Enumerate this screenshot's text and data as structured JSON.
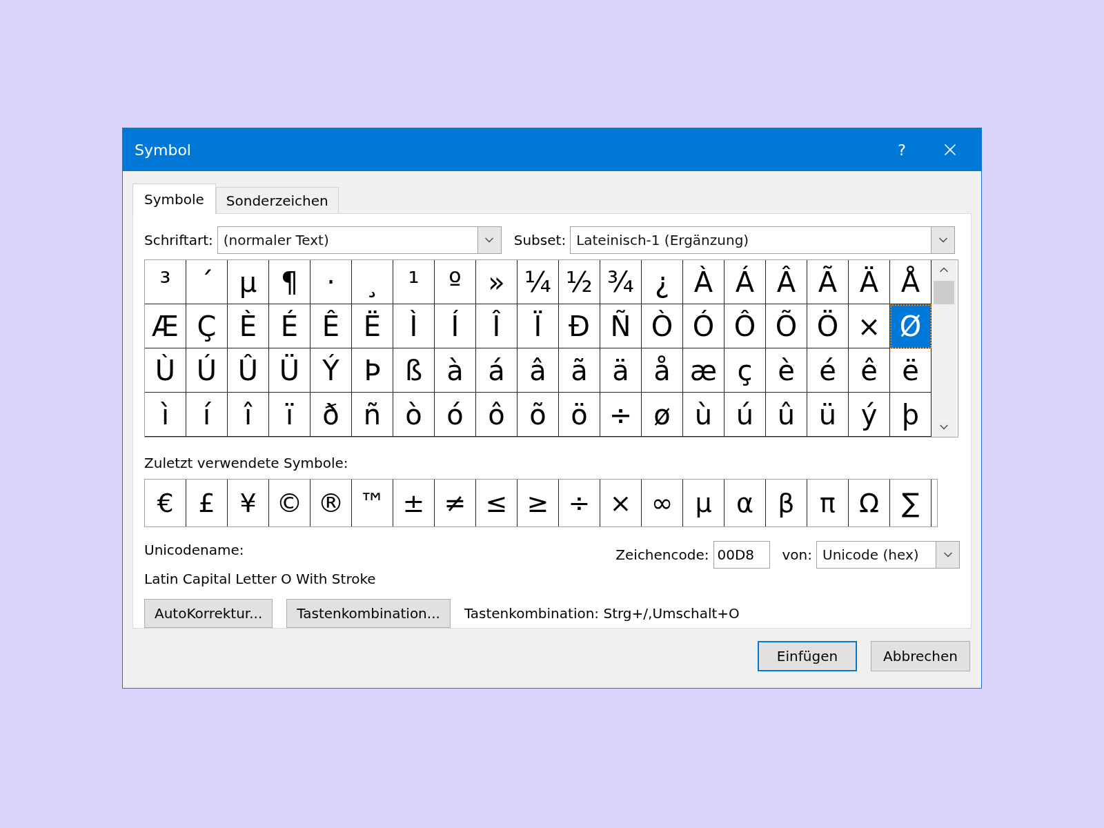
{
  "window": {
    "title": "Symbol",
    "help": "?"
  },
  "tabs": [
    {
      "label": "Symbole",
      "selected": true
    },
    {
      "label": "Sonderzeichen",
      "selected": false
    }
  ],
  "font": {
    "label": "Schriftart:",
    "value": "(normaler Text)"
  },
  "subset": {
    "label": "Subset:",
    "value": "Lateinisch-1 (Ergänzung)"
  },
  "symbol_grid": [
    [
      {
        "char": "³",
        "selected": false
      },
      {
        "char": "´",
        "selected": false
      },
      {
        "char": "µ",
        "selected": false
      },
      {
        "char": "¶",
        "selected": false
      },
      {
        "char": "·",
        "selected": false
      },
      {
        "char": "¸",
        "selected": false
      },
      {
        "char": "¹",
        "selected": false
      },
      {
        "char": "º",
        "selected": false
      },
      {
        "char": "»",
        "selected": false
      },
      {
        "char": "¼",
        "selected": false
      },
      {
        "char": "½",
        "selected": false
      },
      {
        "char": "¾",
        "selected": false
      },
      {
        "char": "¿",
        "selected": false
      },
      {
        "char": "À",
        "selected": false
      },
      {
        "char": "Á",
        "selected": false
      },
      {
        "char": "Â",
        "selected": false
      },
      {
        "char": "Ã",
        "selected": false
      },
      {
        "char": "Ä",
        "selected": false
      },
      {
        "char": "Å",
        "selected": false
      }
    ],
    [
      {
        "char": "Æ",
        "selected": false
      },
      {
        "char": "Ç",
        "selected": false
      },
      {
        "char": "È",
        "selected": false
      },
      {
        "char": "É",
        "selected": false
      },
      {
        "char": "Ê",
        "selected": false
      },
      {
        "char": "Ë",
        "selected": false
      },
      {
        "char": "Ì",
        "selected": false
      },
      {
        "char": "Í",
        "selected": false
      },
      {
        "char": "Î",
        "selected": false
      },
      {
        "char": "Ï",
        "selected": false
      },
      {
        "char": "Ð",
        "selected": false
      },
      {
        "char": "Ñ",
        "selected": false
      },
      {
        "char": "Ò",
        "selected": false
      },
      {
        "char": "Ó",
        "selected": false
      },
      {
        "char": "Ô",
        "selected": false
      },
      {
        "char": "Õ",
        "selected": false
      },
      {
        "char": "Ö",
        "selected": false
      },
      {
        "char": "×",
        "selected": false
      },
      {
        "char": "Ø",
        "selected": true
      }
    ],
    [
      {
        "char": "Ù",
        "selected": false
      },
      {
        "char": "Ú",
        "selected": false
      },
      {
        "char": "Û",
        "selected": false
      },
      {
        "char": "Ü",
        "selected": false
      },
      {
        "char": "Ý",
        "selected": false
      },
      {
        "char": "Þ",
        "selected": false
      },
      {
        "char": "ß",
        "selected": false
      },
      {
        "char": "à",
        "selected": false
      },
      {
        "char": "á",
        "selected": false
      },
      {
        "char": "â",
        "selected": false
      },
      {
        "char": "ã",
        "selected": false
      },
      {
        "char": "ä",
        "selected": false
      },
      {
        "char": "å",
        "selected": false
      },
      {
        "char": "æ",
        "selected": false
      },
      {
        "char": "ç",
        "selected": false
      },
      {
        "char": "è",
        "selected": false
      },
      {
        "char": "é",
        "selected": false
      },
      {
        "char": "ê",
        "selected": false
      },
      {
        "char": "ë",
        "selected": false
      }
    ],
    [
      {
        "char": "ì",
        "selected": false
      },
      {
        "char": "í",
        "selected": false
      },
      {
        "char": "î",
        "selected": false
      },
      {
        "char": "ï",
        "selected": false
      },
      {
        "char": "ð",
        "selected": false
      },
      {
        "char": "ñ",
        "selected": false
      },
      {
        "char": "ò",
        "selected": false
      },
      {
        "char": "ó",
        "selected": false
      },
      {
        "char": "ô",
        "selected": false
      },
      {
        "char": "õ",
        "selected": false
      },
      {
        "char": "ö",
        "selected": false
      },
      {
        "char": "÷",
        "selected": false
      },
      {
        "char": "ø",
        "selected": false
      },
      {
        "char": "ù",
        "selected": false
      },
      {
        "char": "ú",
        "selected": false
      },
      {
        "char": "û",
        "selected": false
      },
      {
        "char": "ü",
        "selected": false
      },
      {
        "char": "ý",
        "selected": false
      },
      {
        "char": "þ",
        "selected": false
      }
    ]
  ],
  "recent": {
    "label": "Zuletzt verwendete Symbole:",
    "symbols": [
      "€",
      "£",
      "¥",
      "©",
      "®",
      "™",
      "±",
      "≠",
      "≤",
      "≥",
      "÷",
      "×",
      "∞",
      "µ",
      "α",
      "β",
      "π",
      "Ω",
      "∑"
    ]
  },
  "unicode_name": {
    "label": "Unicodename:",
    "value": "Latin Capital Letter O With Stroke"
  },
  "char_code": {
    "label": "Zeichencode:",
    "value": "00D8"
  },
  "from": {
    "label": "von:",
    "value": "Unicode (hex)"
  },
  "buttons": [
    "AutoKorrektur...",
    "Tastenkombination..."
  ],
  "shortcut_text": "Tastenkombination: Strg+/,Umschalt+O",
  "footer_buttons": [
    {
      "label": "Einfügen",
      "default": true
    },
    {
      "label": "Abbrechen",
      "default": false
    }
  ]
}
